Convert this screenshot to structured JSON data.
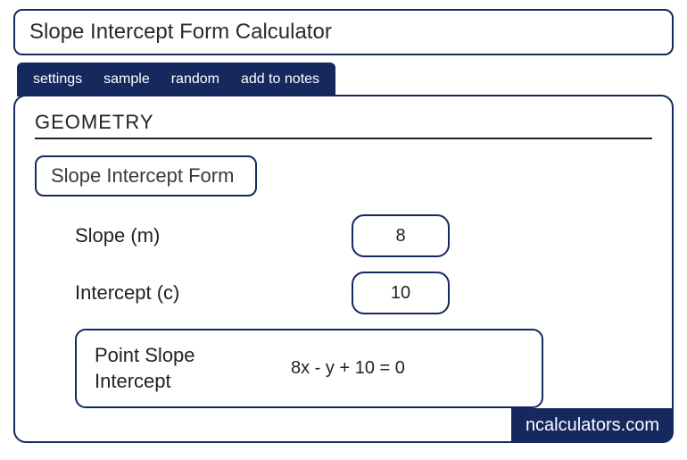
{
  "title": "Slope Intercept Form Calculator",
  "tabs": {
    "settings": "settings",
    "sample": "sample",
    "random": "random",
    "add_to_notes": "add to notes"
  },
  "section": "GEOMETRY",
  "form_heading": "Slope Intercept Form",
  "fields": {
    "slope": {
      "label": "Slope (m)",
      "value": "8"
    },
    "intercept": {
      "label": "Intercept (c)",
      "value": "10"
    }
  },
  "result": {
    "label": "Point Slope Intercept",
    "value": "8x - y + 10 = 0"
  },
  "brand": "ncalculators.com"
}
